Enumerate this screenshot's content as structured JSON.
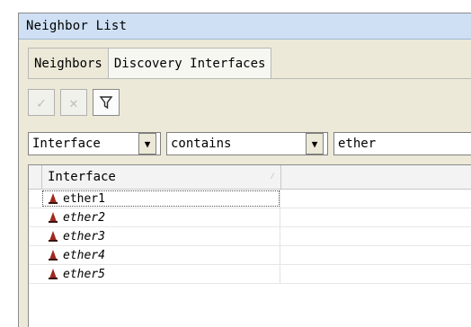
{
  "window": {
    "title": "Neighbor List"
  },
  "tabs": [
    {
      "label": "Neighbors",
      "active": false
    },
    {
      "label": "Discovery Interfaces",
      "active": true
    }
  ],
  "toolbar": {
    "buttons": [
      {
        "name": "enable-button",
        "icon": "checkmark-icon",
        "enabled": false
      },
      {
        "name": "disable-button",
        "icon": "x-icon",
        "enabled": false
      },
      {
        "name": "filter-button",
        "icon": "funnel-icon",
        "enabled": true
      }
    ]
  },
  "filter": {
    "field": "Interface",
    "operator": "contains",
    "value": "ether",
    "dropdown_glyph": "▼"
  },
  "grid": {
    "columns": [
      {
        "label": "Interface"
      }
    ],
    "rows": [
      {
        "name": "ether1",
        "italic": false,
        "selected": true
      },
      {
        "name": "ether2",
        "italic": true,
        "selected": false
      },
      {
        "name": "ether3",
        "italic": true,
        "selected": false
      },
      {
        "name": "ether4",
        "italic": true,
        "selected": false
      },
      {
        "name": "ether5",
        "italic": true,
        "selected": false
      }
    ]
  },
  "colors": {
    "icon_red": "#a0281e",
    "icon_dark": "#3a1410"
  }
}
